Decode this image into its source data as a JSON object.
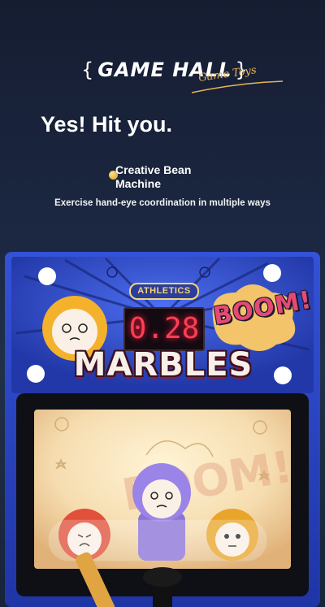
{
  "header": {
    "brand_left": "{",
    "brand_name": "GAME HALL",
    "brand_right": "}",
    "brand_script": "Game Toys",
    "headline": "Yes! Hit you.",
    "feature": "Creative Bean Machine",
    "subline": "Exercise hand-eye coordination in multiple ways"
  },
  "machine": {
    "badge": "ATHLETICS",
    "display_value": "0.28",
    "title": "MARBLES",
    "boom_text": "BOOM!"
  },
  "colors": {
    "machine_blue": "#2f4bd1",
    "accent_gold": "#f6d57a",
    "display_red": "#ff3d55"
  }
}
